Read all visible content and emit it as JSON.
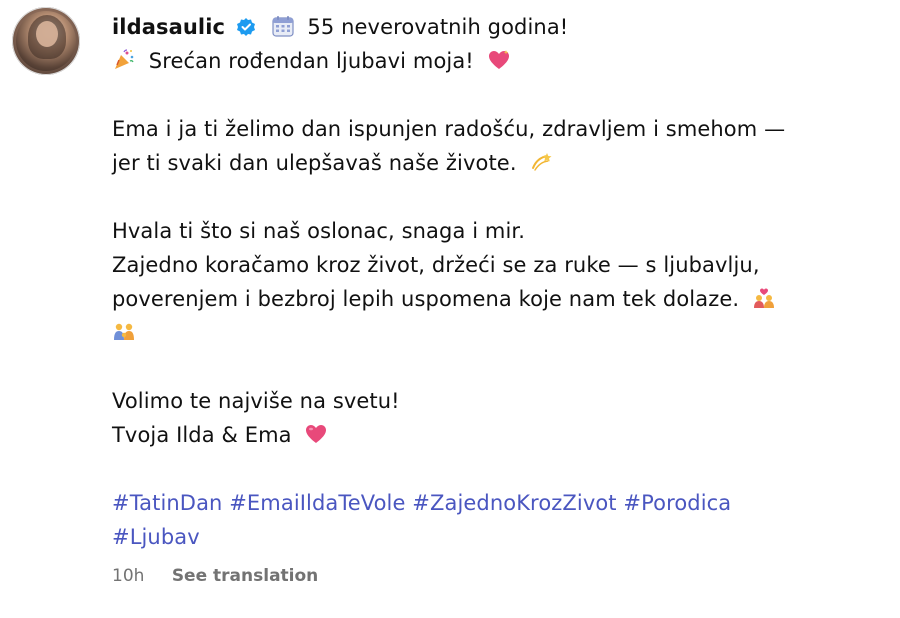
{
  "post": {
    "username": "ildasaulic",
    "headline": "55 neverovatnih godina!",
    "lines": {
      "greeting": "Srećan rođendan ljubavi moja!",
      "p1_l1": "Ema i ja ti želimo dan ispunjen radošću, zdravljem i smehom —",
      "p1_l2": "jer ti svaki dan ulepšavaš naše živote.",
      "p2_l1": "Hvala ti što si naš oslonac, snaga i mir.",
      "p2_l2": "Zajedno koračamo kroz život, držeći se za ruke — s ljubavlju,",
      "p2_l3": "poverenjem i bezbroj lepih uspomena koje nam tek dolaze.",
      "p3_l1": "Volimo te najviše na svetu!",
      "p3_l2": "Tvoja Ilda & Ema"
    },
    "hashtags": {
      "row1": [
        "#TatinDan",
        "#EmaiIldaTeVole",
        "#ZajednoKrozZivot",
        "#Porodica"
      ],
      "row2": [
        "#Ljubav"
      ]
    },
    "time": "10h",
    "see_translation": "See translation"
  },
  "icons": {
    "verified": "verified-badge-icon",
    "calendar": "calendar-emoji-icon",
    "party": "party-popper-emoji-icon",
    "heart_sparkle": "sparkling-heart-emoji-icon",
    "dizzy": "dizzy-star-emoji-icon",
    "couple_heart": "couple-with-heart-emoji-icon",
    "family": "family-emoji-icon",
    "heart": "heart-emoji-icon"
  },
  "colors": {
    "hashtag": "#4a56c0",
    "verified": "#1d9bf0",
    "meta": "#737373"
  }
}
